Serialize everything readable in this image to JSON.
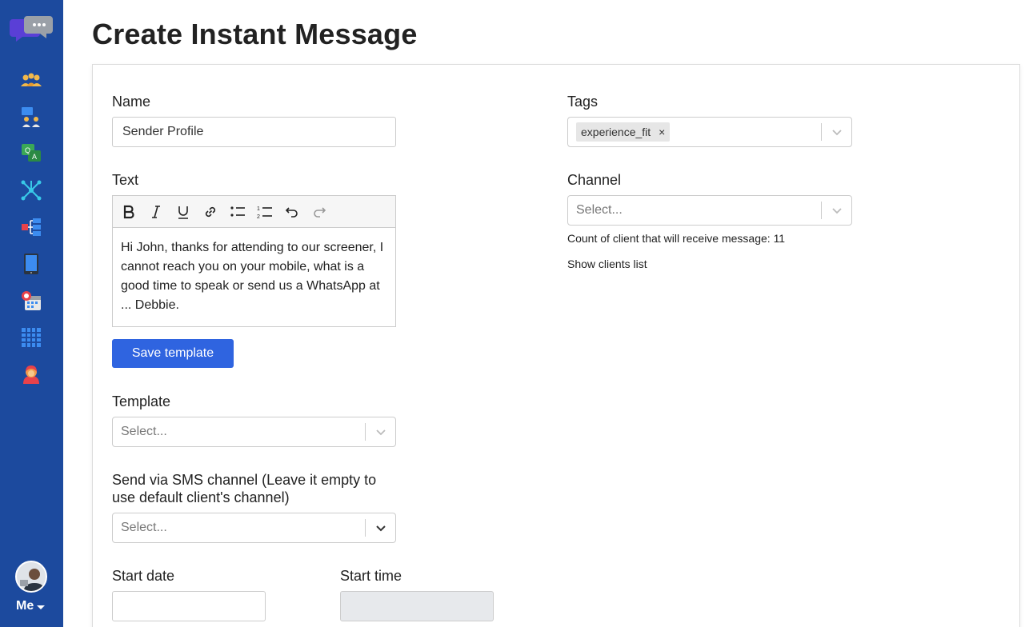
{
  "sidebar": {
    "items": [
      {
        "name": "contacts-icon"
      },
      {
        "name": "team-icon"
      },
      {
        "name": "qa-chat-icon"
      },
      {
        "name": "network-icon"
      },
      {
        "name": "hierarchy-icon"
      },
      {
        "name": "tablet-icon"
      },
      {
        "name": "calendar-alert-icon"
      },
      {
        "name": "grid-icon"
      },
      {
        "name": "agent-icon"
      }
    ],
    "me_label": "Me"
  },
  "page": {
    "title": "Create Instant Message"
  },
  "form": {
    "name": {
      "label": "Name",
      "value": "Sender Profile"
    },
    "text": {
      "label": "Text",
      "body": "Hi John, thanks for attending to our screener, I cannot reach you on your mobile, what is a good time to speak or send us a WhatsApp at ... Debbie."
    },
    "save_template_label": "Save template",
    "template": {
      "label": "Template",
      "placeholder": "Select..."
    },
    "sms_channel": {
      "label": "Send via SMS channel (Leave it empty to use default client's channel)",
      "placeholder": "Select..."
    },
    "start_date": {
      "label": "Start date",
      "value": ""
    },
    "start_time": {
      "label": "Start time",
      "value": ""
    },
    "tags": {
      "label": "Tags",
      "items": [
        "experience_fit"
      ],
      "remove_symbol": "×"
    },
    "channel": {
      "label": "Channel",
      "placeholder": "Select..."
    },
    "count_text": "Count of client that will receive message: 11",
    "show_clients_label": "Show clients list"
  },
  "colors": {
    "sidebar_bg": "#1c4a9e",
    "primary": "#2f64e0"
  }
}
